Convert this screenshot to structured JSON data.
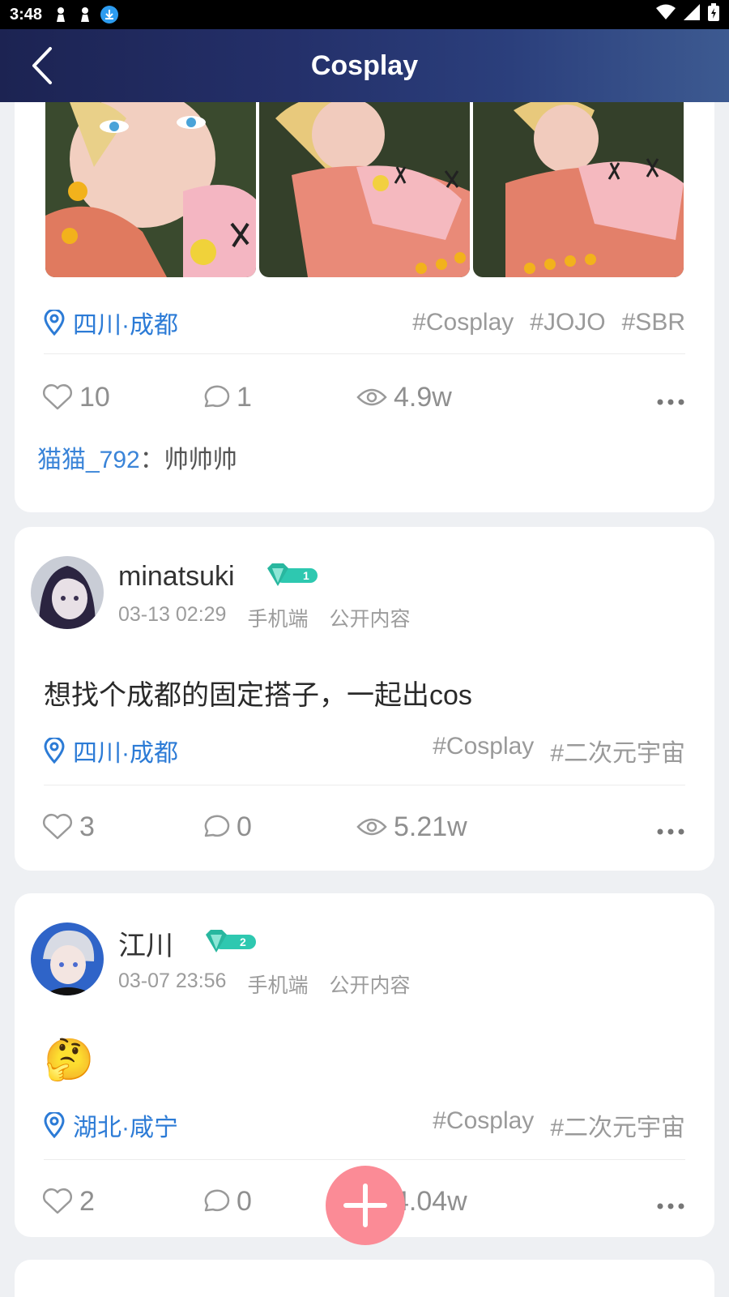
{
  "status_bar": {
    "time": "3:48"
  },
  "header": {
    "title": "Cosplay"
  },
  "posts": [
    {
      "location": "四川·成都",
      "tags": [
        "#Cosplay",
        "#JOJO",
        "#SBR"
      ],
      "likes": "10",
      "comments": "1",
      "views": "4.9w",
      "reply": {
        "user": "猫猫_792",
        "sep": "：",
        "text": "帅帅帅"
      }
    },
    {
      "username": "minatsuki",
      "level": "1",
      "date": "03-13 02:29",
      "device": "手机端",
      "visibility": "公开内容",
      "text": "想找个成都的固定搭子，一起出cos",
      "location": "四川·成都",
      "tags": [
        "#Cosplay",
        "#二次元宇宙"
      ],
      "likes": "3",
      "comments": "0",
      "views": "5.21w"
    },
    {
      "username": "江川",
      "level": "2",
      "date": "03-07 23:56",
      "device": "手机端",
      "visibility": "公开内容",
      "emoji": "🤔",
      "location": "湖北·咸宁",
      "tags": [
        "#Cosplay",
        "#二次元宇宙"
      ],
      "likes": "2",
      "comments": "0",
      "views": "4.04w"
    }
  ],
  "colors": {
    "accent_blue": "#2c7bd6",
    "fab_pink": "#fb8b96",
    "badge_teal": "#2ec8b0"
  },
  "icons": [
    "back-arrow-icon",
    "location-pin-icon",
    "heart-icon",
    "comment-bubble-icon",
    "eye-icon",
    "more-dots-icon",
    "plus-icon"
  ]
}
